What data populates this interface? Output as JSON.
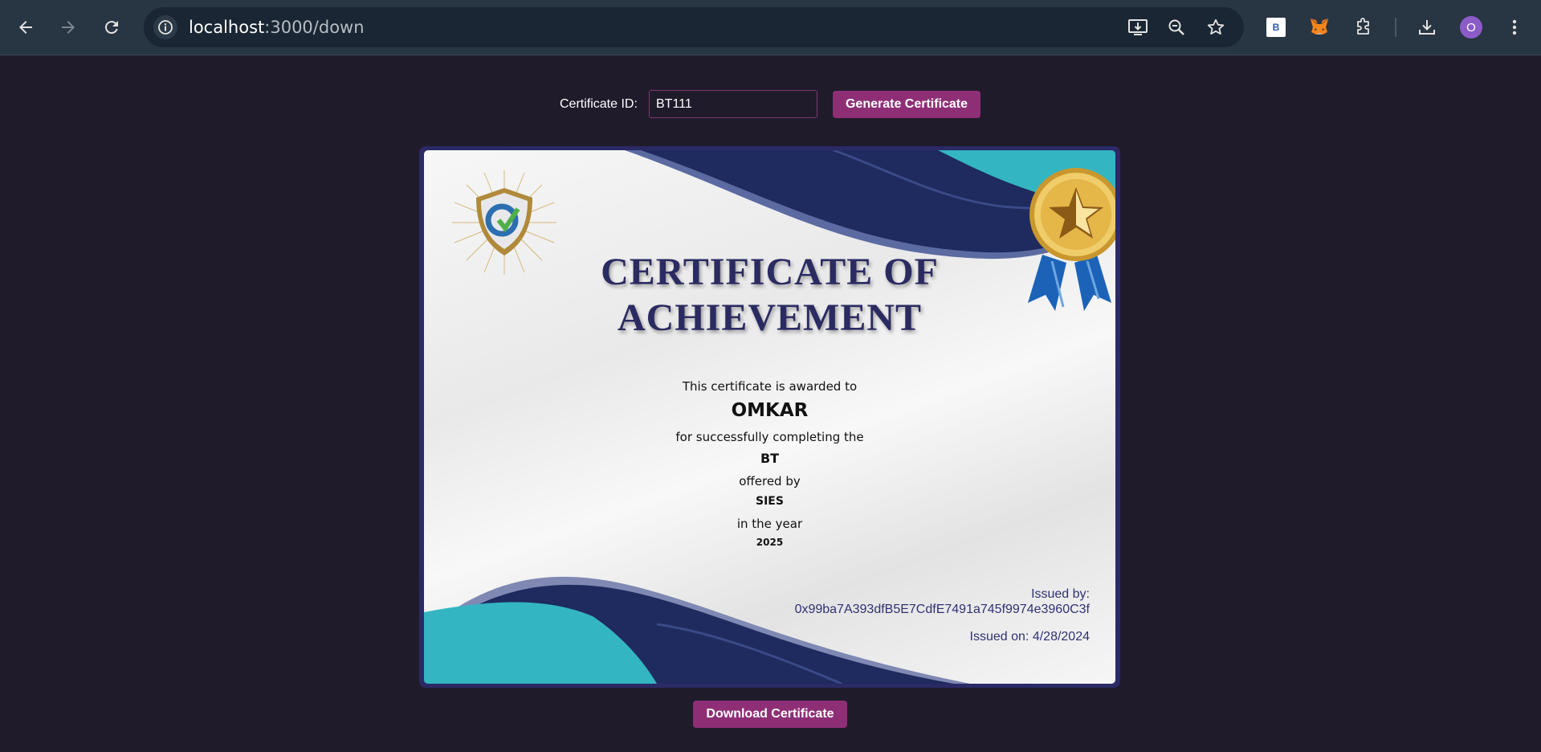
{
  "browser": {
    "url_host": "localhost",
    "url_path": ":3000/down",
    "profile_initial": "O",
    "extension_b_label": "B"
  },
  "form": {
    "label": "Certificate ID:",
    "input_value": "BT111",
    "generate_label": "Generate Certificate"
  },
  "certificate": {
    "title_line1": "CERTIFICATE OF",
    "title_line2": "ACHIEVEMENT",
    "awarded_to_text": "This certificate is awarded to",
    "recipient": "OMKAR",
    "completing_text": "for successfully completing the",
    "course": "BT",
    "offered_by_text": "offered by",
    "institution": "SIES",
    "year_text": "in the year",
    "year": "2025",
    "issued_by_label": "Issued by:",
    "issuer_address": "0x99ba7A393dfB5E7CdfE7491a745f9974e3960C3f",
    "issued_on": "Issued on: 4/28/2024"
  },
  "download_label": "Download Certificate",
  "colors": {
    "background": "#1f1b2b",
    "accent_button": "#8e2f76",
    "certificate_navy": "#1f2a5e",
    "certificate_teal": "#33b5c2"
  }
}
